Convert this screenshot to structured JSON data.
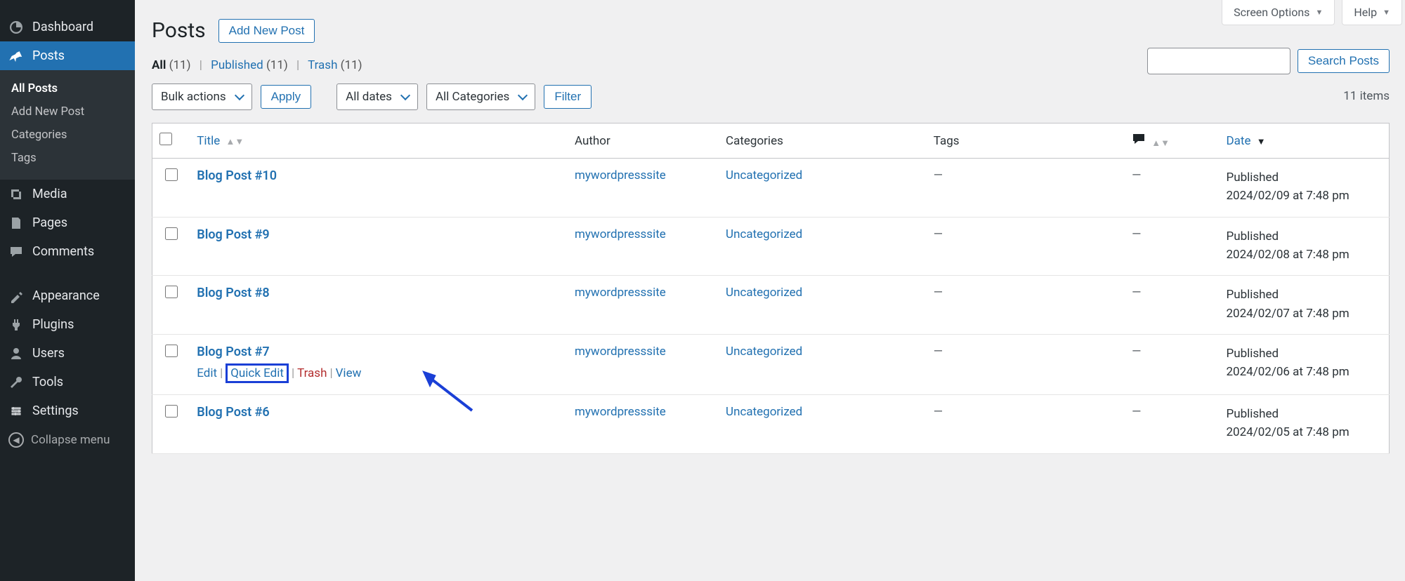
{
  "sidebar": {
    "dashboard": "Dashboard",
    "posts": "Posts",
    "media": "Media",
    "pages": "Pages",
    "comments": "Comments",
    "appearance": "Appearance",
    "plugins": "Plugins",
    "users": "Users",
    "tools": "Tools",
    "settings": "Settings",
    "collapse": "Collapse menu",
    "submenu": {
      "all_posts": "All Posts",
      "add_new": "Add New Post",
      "categories": "Categories",
      "tags": "Tags"
    }
  },
  "top": {
    "screen_options": "Screen Options",
    "help": "Help"
  },
  "header": {
    "title": "Posts",
    "add_new": "Add New Post"
  },
  "status": {
    "all_label": "All",
    "all_count": "(11)",
    "published_label": "Published",
    "published_count": "(11)",
    "trash_label": "Trash",
    "trash_count": "(11)"
  },
  "filters": {
    "bulk": "Bulk actions",
    "apply": "Apply",
    "dates": "All dates",
    "categories": "All Categories",
    "filter": "Filter",
    "items_count": "11 items"
  },
  "search": {
    "button": "Search Posts"
  },
  "columns": {
    "title": "Title",
    "author": "Author",
    "categories": "Categories",
    "tags": "Tags",
    "date": "Date"
  },
  "row_actions": {
    "edit": "Edit",
    "quick_edit": "Quick Edit",
    "trash": "Trash",
    "view": "View"
  },
  "posts": [
    {
      "title": "Blog Post #10",
      "author": "mywordpresssite",
      "category": "Uncategorized",
      "tags": "—",
      "comments": "—",
      "published_label": "Published",
      "date": "2024/02/09 at 7:48 pm",
      "show_actions": false
    },
    {
      "title": "Blog Post #9",
      "author": "mywordpresssite",
      "category": "Uncategorized",
      "tags": "—",
      "comments": "—",
      "published_label": "Published",
      "date": "2024/02/08 at 7:48 pm",
      "show_actions": false
    },
    {
      "title": "Blog Post #8",
      "author": "mywordpresssite",
      "category": "Uncategorized",
      "tags": "—",
      "comments": "—",
      "published_label": "Published",
      "date": "2024/02/07 at 7:48 pm",
      "show_actions": false
    },
    {
      "title": "Blog Post #7",
      "author": "mywordpresssite",
      "category": "Uncategorized",
      "tags": "—",
      "comments": "—",
      "published_label": "Published",
      "date": "2024/02/06 at 7:48 pm",
      "show_actions": true
    },
    {
      "title": "Blog Post #6",
      "author": "mywordpresssite",
      "category": "Uncategorized",
      "tags": "—",
      "comments": "—",
      "published_label": "Published",
      "date": "2024/02/05 at 7:48 pm",
      "show_actions": false
    }
  ]
}
